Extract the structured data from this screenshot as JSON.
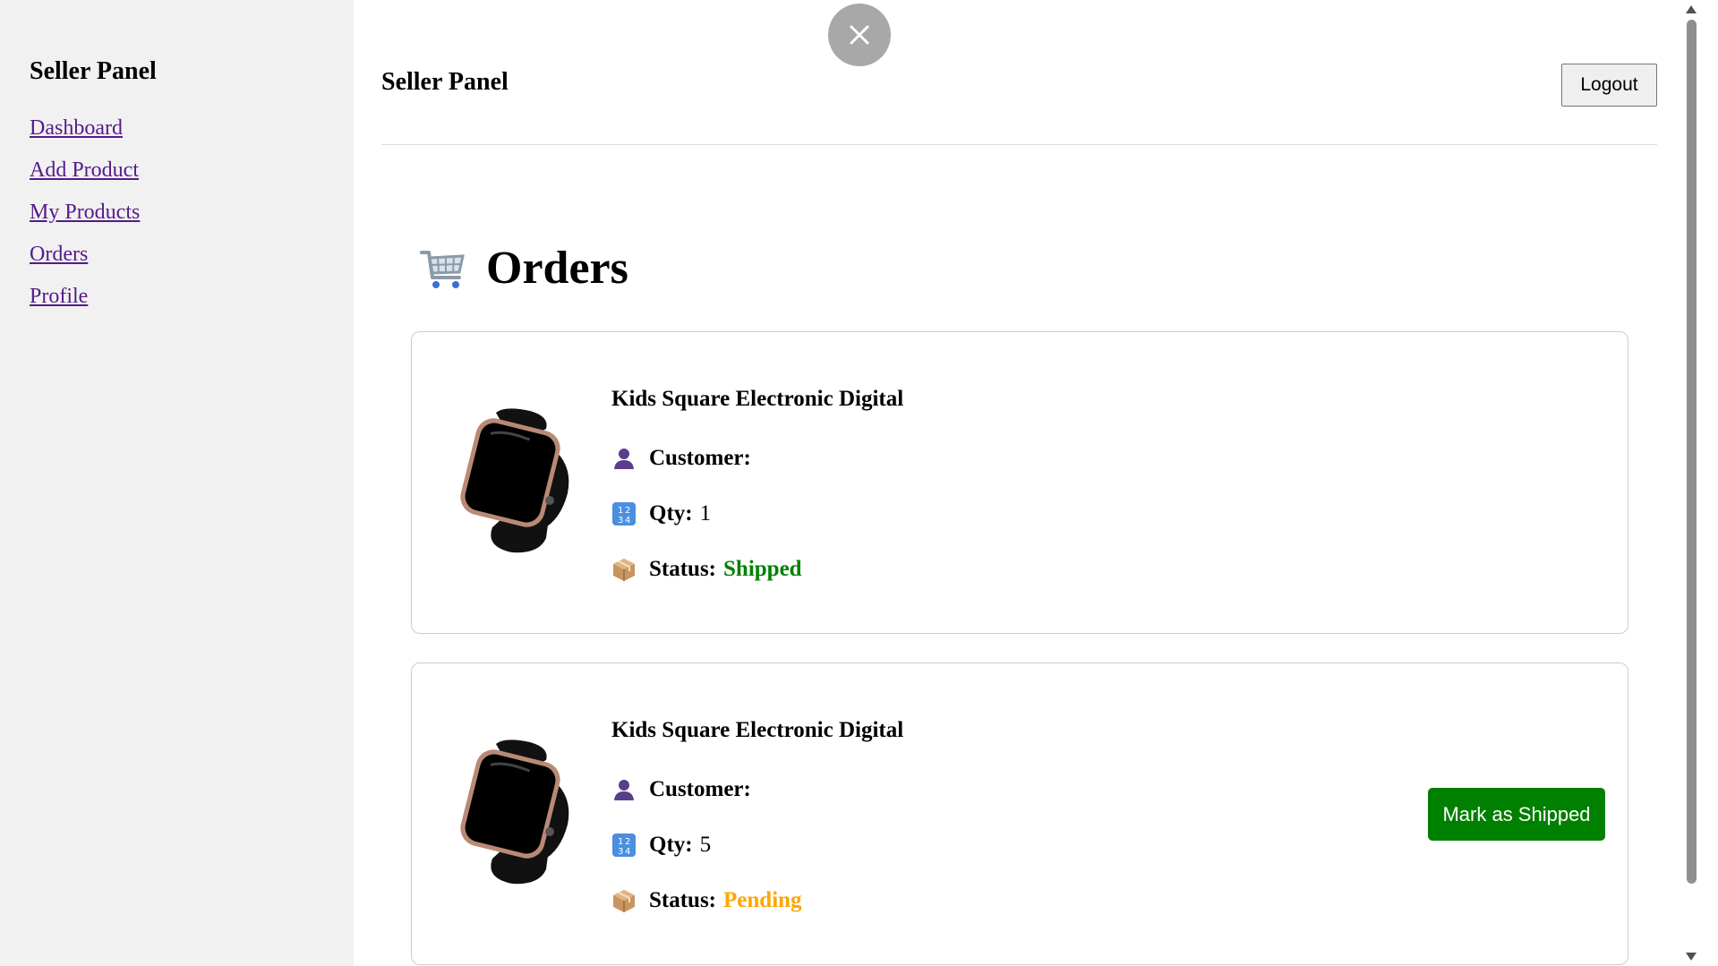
{
  "sidebar": {
    "title": "Seller Panel",
    "links": [
      "Dashboard",
      "Add Product",
      "My Products",
      "Orders",
      "Profile"
    ]
  },
  "header": {
    "title": "Seller Panel",
    "logout_label": "Logout"
  },
  "page": {
    "title": "Orders",
    "title_icon": "shopping-cart-icon"
  },
  "labels": {
    "customer": "Customer:",
    "qty": "Qty:",
    "status": "Status:"
  },
  "orders": [
    {
      "product_name": "Kids Square Electronic Digital",
      "customer": "",
      "qty": "1",
      "status": "Shipped",
      "status_color": "#008000"
    },
    {
      "product_name": "Kids Square Electronic Digital",
      "customer": "",
      "qty": "5",
      "status": "Pending",
      "status_color": "#ffa500",
      "action_label": "Mark as Shipped"
    }
  ],
  "colors": {
    "sidebar_bg": "#f1f1f1",
    "link": "#551a8b",
    "ship_button": "#008000"
  }
}
